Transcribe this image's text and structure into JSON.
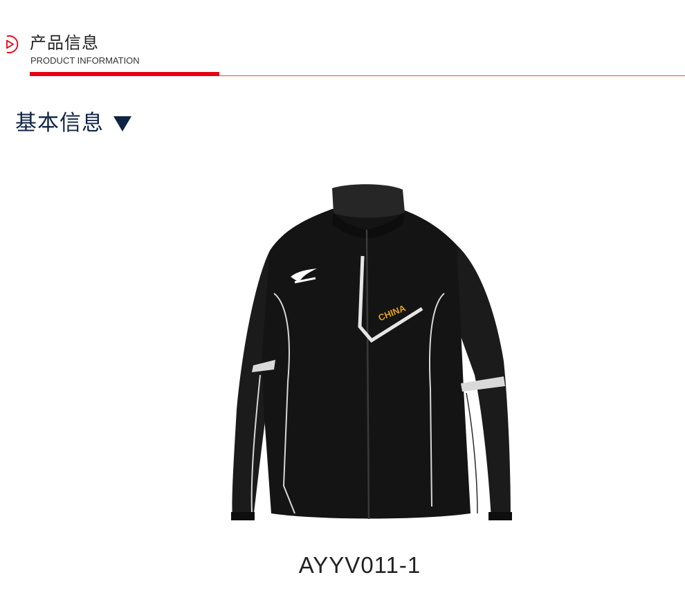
{
  "header": {
    "title_cn": "产品信息",
    "title_en": "PRODUCT INFORMATION",
    "icon": "play-circle-icon",
    "accent_color": "#e60012"
  },
  "section": {
    "title": "基本信息",
    "icon": "triangle-down-icon",
    "color": "#0f2444"
  },
  "product": {
    "image": "black-jacket-image",
    "chest_text": "CHINA",
    "code": "AYYV011-1"
  }
}
